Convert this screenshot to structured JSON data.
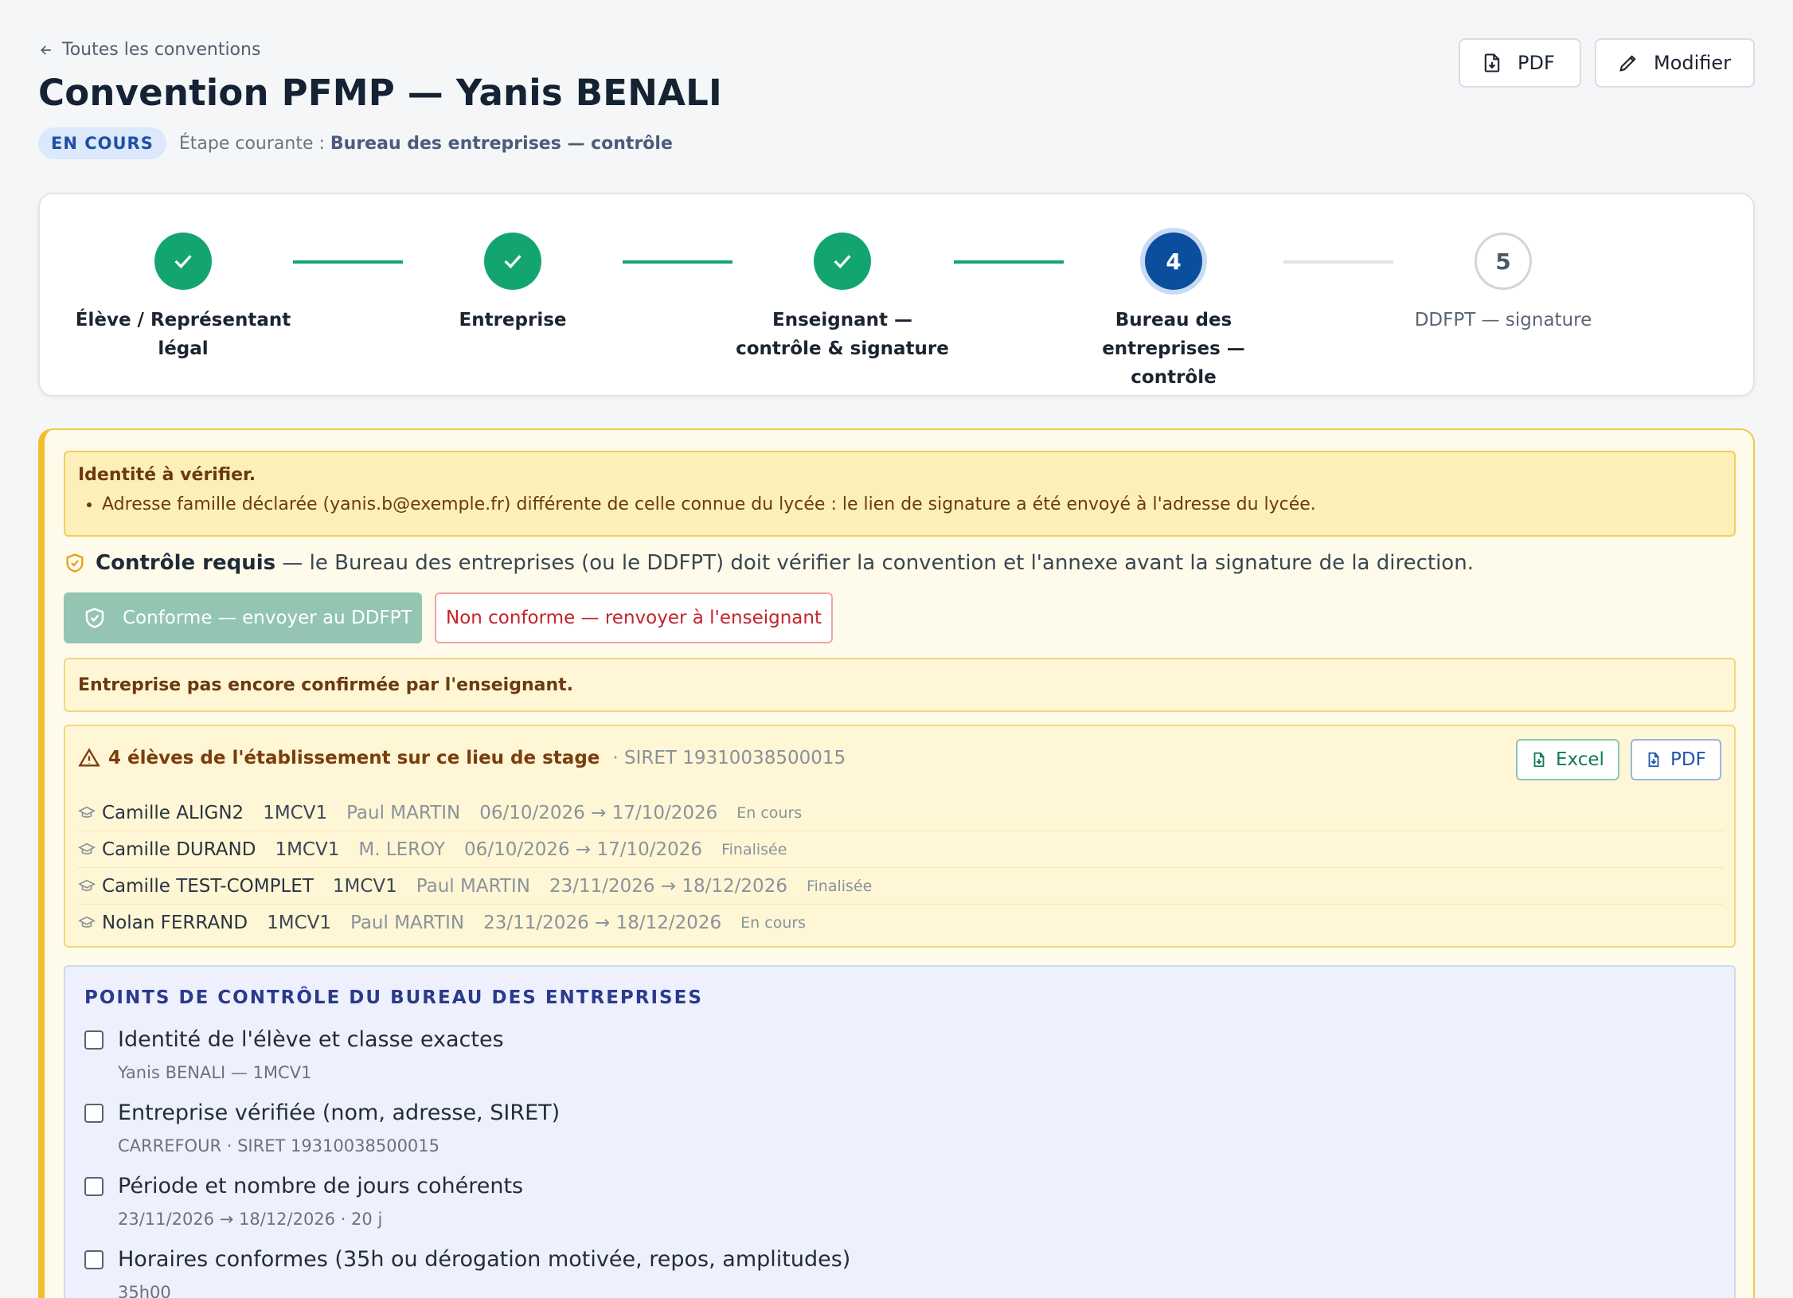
{
  "header": {
    "back_label": "Toutes les conventions",
    "title": "Convention PFMP — Yanis BENALI",
    "status_badge": "EN COURS",
    "stage_prefix": "Étape courante :",
    "stage_value": "Bureau des entreprises — contrôle",
    "pdf_label": "PDF",
    "edit_label": "Modifier"
  },
  "steps": [
    {
      "state": "done",
      "number": "",
      "label": "Élève / Représentant légal"
    },
    {
      "state": "done",
      "number": "",
      "label": "Entreprise"
    },
    {
      "state": "done",
      "number": "",
      "label": "Enseignant — contrôle & signature"
    },
    {
      "state": "current",
      "number": "4",
      "label": "Bureau des entreprises — contrôle"
    },
    {
      "state": "todo",
      "number": "5",
      "label": "DDFPT — signature"
    }
  ],
  "alert": {
    "title": "Identité à vérifier.",
    "items": [
      "Adresse famille déclarée (yanis.b@exemple.fr) différente de celle connue du lycée : le lien de signature a été envoyé à l'adresse du lycée."
    ]
  },
  "control": {
    "title": "Contrôle requis",
    "text": " — le Bureau des entreprises (ou le DDFPT) doit vérifier la convention et l'annexe avant la signature de la direction.",
    "ok_label": "Conforme — envoyer au DDFPT",
    "ko_label": "Non conforme — renvoyer à l'enseignant"
  },
  "note": "Entreprise pas encore confirmée par l'enseignant.",
  "students_panel": {
    "title": "4 élèves de l'établissement sur ce lieu de stage",
    "siret": "· SIRET 19310038500015",
    "excel_label": "Excel",
    "pdf_label": "PDF",
    "rows": [
      {
        "name": "Camille ALIGN2",
        "class": "1MCV1",
        "teacher": "Paul MARTIN",
        "dates": "06/10/2026 → 17/10/2026",
        "status": "En cours"
      },
      {
        "name": "Camille DURAND",
        "class": "1MCV1",
        "teacher": "M. LEROY",
        "dates": "06/10/2026 → 17/10/2026",
        "status": "Finalisée"
      },
      {
        "name": "Camille TEST-COMPLET",
        "class": "1MCV1",
        "teacher": "Paul MARTIN",
        "dates": "23/11/2026 → 18/12/2026",
        "status": "Finalisée"
      },
      {
        "name": "Nolan FERRAND",
        "class": "1MCV1",
        "teacher": "Paul MARTIN",
        "dates": "23/11/2026 → 18/12/2026",
        "status": "En cours"
      }
    ]
  },
  "checks": {
    "title": "POINTS DE CONTRÔLE DU BUREAU DES ENTREPRISES",
    "items": [
      {
        "label": "Identité de l'élève et classe exactes",
        "detail": "Yanis BENALI — 1MCV1"
      },
      {
        "label": "Entreprise vérifiée (nom, adresse, SIRET)",
        "detail": "CARREFOUR · SIRET 19310038500015"
      },
      {
        "label": "Période et nombre de jours cohérents",
        "detail": "23/11/2026 → 18/12/2026 · 20 j"
      },
      {
        "label": "Horaires conformes (35h ou dérogation motivée, repos, amplitudes)",
        "detail": "35h00"
      }
    ]
  },
  "colors": {
    "success": "#13a570",
    "current": "#0b4e9e",
    "warning_border": "#f3be2c",
    "danger": "#c4232b"
  }
}
